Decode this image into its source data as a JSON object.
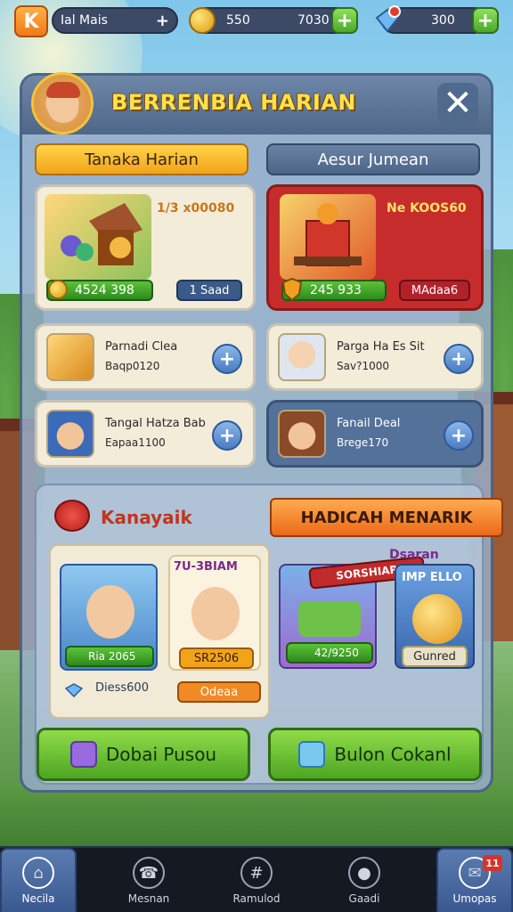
{
  "topbar": {
    "logo_letter": "K",
    "profile_label": "Ial Mais",
    "coins_value": "550",
    "coins_value2": "7030",
    "gems_value": "300",
    "plus_symbol": "+"
  },
  "panel": {
    "title": "BERRENBIA HARIAN",
    "close_symbol": "✕",
    "tabs": [
      {
        "label": "Tanaka Harian"
      },
      {
        "label": "Aesur Jumean"
      }
    ]
  },
  "cards": {
    "featured_left": {
      "title": "1/3 x00080",
      "price": "4524 398",
      "button": "1 Saad"
    },
    "featured_right": {
      "title": "Ne KOOS60",
      "price": "245 933",
      "button": "MAdaa6"
    },
    "item1": {
      "line1": "Parnadi Clea",
      "line2": "Baqp0120"
    },
    "item2": {
      "line1": "Parga Ha Es Sit",
      "line2": "Sav?1000"
    },
    "item3": {
      "line1": "Tangal Hatza Bab",
      "line2": "Eapaa1100"
    },
    "item4": {
      "line1": "Fanail Deal",
      "line2": "Brege170"
    }
  },
  "lower": {
    "section_title": "Kanayaik",
    "ribbon_label": "HADICAH MENARIK",
    "char1": {
      "price": "Ria 2065",
      "label": "Diess600"
    },
    "char2": {
      "title": "7U-3BIAM",
      "price": "SR2506",
      "label": "Odeaa"
    },
    "bundle1": {
      "banner": "SORSHIAR",
      "banner2": "Dsaran",
      "price": "42/9250"
    },
    "bundle2": {
      "title": "IMP ELLO",
      "label": "Gunred"
    },
    "btn_left": "Dobai Pusou",
    "btn_right": "Bulon Cokanl"
  },
  "nav": {
    "items": [
      {
        "label": "Necila",
        "icon": "home-icon"
      },
      {
        "label": "Mesnan",
        "icon": "phone-icon"
      },
      {
        "label": "Ramulod",
        "icon": "grid-icon"
      },
      {
        "label": "Gaadi",
        "icon": "pin-icon"
      },
      {
        "label": "Umopas",
        "icon": "map-icon",
        "badge": "11"
      }
    ]
  },
  "colors": {
    "accent_orange": "#f2a418",
    "panel_blue": "#4c6486",
    "featured_red": "#c72c2c",
    "button_green": "#4ea622",
    "title_yellow": "#ffe24a"
  }
}
